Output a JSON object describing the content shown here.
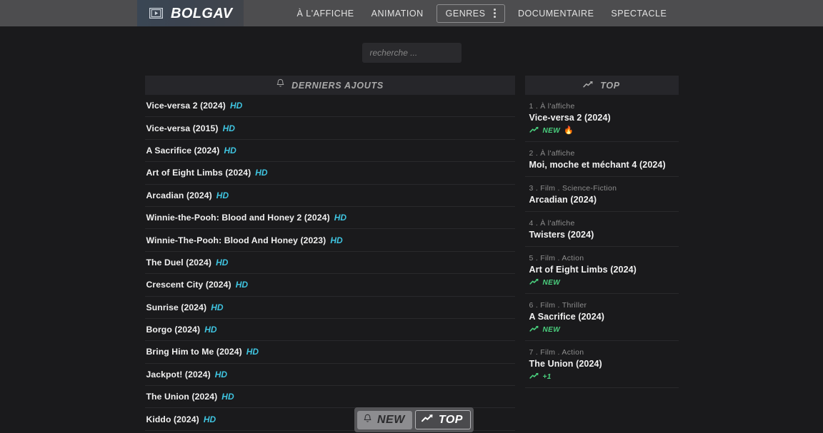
{
  "navbar": {
    "brand": {
      "text": "BOLGAV",
      "icon": "film-play-icon"
    },
    "links": [
      {
        "label": "À L'AFFICHE",
        "name": "nav-a-laffiche",
        "boxed": false
      },
      {
        "label": "ANIMATION",
        "name": "nav-animation",
        "boxed": false
      },
      {
        "label": "GENRES",
        "name": "nav-genres",
        "boxed": true
      },
      {
        "label": "DOCUMENTAIRE",
        "name": "nav-documentaire",
        "boxed": false
      },
      {
        "label": "SPECTACLE",
        "name": "nav-spectacle",
        "boxed": false
      }
    ]
  },
  "search": {
    "placeholder": "recherche ...",
    "value": ""
  },
  "latest": {
    "header": {
      "title": "DERNIERS AJOUTS",
      "icon": "bell-icon"
    },
    "items": [
      {
        "title": "Vice-versa 2 (2024)",
        "tag": "HD"
      },
      {
        "title": "Vice-versa (2015)",
        "tag": "HD"
      },
      {
        "title": "A Sacrifice (2024)",
        "tag": "HD"
      },
      {
        "title": "Art of Eight Limbs (2024)",
        "tag": "HD"
      },
      {
        "title": "Arcadian (2024)",
        "tag": "HD"
      },
      {
        "title": "Winnie-the-Pooh: Blood and Honey 2 (2024)",
        "tag": "HD"
      },
      {
        "title": "Winnie-The-Pooh: Blood And Honey (2023)",
        "tag": "HD"
      },
      {
        "title": "The Duel (2024)",
        "tag": "HD"
      },
      {
        "title": "Crescent City (2024)",
        "tag": "HD"
      },
      {
        "title": "Sunrise (2024)",
        "tag": "HD"
      },
      {
        "title": "Borgo (2024)",
        "tag": "HD"
      },
      {
        "title": "Bring Him to Me (2024)",
        "tag": "HD"
      },
      {
        "title": "Jackpot! (2024)",
        "tag": "HD"
      },
      {
        "title": "The Union (2024)",
        "tag": "HD"
      },
      {
        "title": "Kiddo (2024)",
        "tag": "HD"
      }
    ]
  },
  "top": {
    "header": {
      "title": "TOP",
      "icon": "trending-up-icon"
    },
    "items": [
      {
        "meta": "1 . À l'affiche",
        "name": "Vice-versa 2 (2024)",
        "badge": "NEW",
        "fire": "🔥"
      },
      {
        "meta": "2 . À l'affiche",
        "name": "Moi, moche et méchant 4 (2024)",
        "badge": "",
        "fire": ""
      },
      {
        "meta": "3 . Film . Science-Fiction",
        "name": "Arcadian (2024)",
        "badge": "",
        "fire": ""
      },
      {
        "meta": "4 . À l'affiche",
        "name": "Twisters (2024)",
        "badge": "",
        "fire": ""
      },
      {
        "meta": "5 . Film . Action",
        "name": "Art of Eight Limbs (2024)",
        "badge": "NEW",
        "fire": ""
      },
      {
        "meta": "6 . Film . Thriller",
        "name": "A Sacrifice (2024)",
        "badge": "NEW",
        "fire": ""
      },
      {
        "meta": "7 . Film . Action",
        "name": "The Union (2024)",
        "badge": "+1",
        "fire": ""
      }
    ]
  },
  "floating": {
    "new_label": "NEW",
    "new_icon": "bell-icon",
    "top_label": "TOP",
    "top_icon": "trending-up-icon"
  },
  "colors": {
    "accent_hd": "#3fc4e0",
    "accent_badge": "#4ad07e",
    "navbar_bg": "#4d4d4f",
    "page_bg": "#1a1a1c",
    "panel_head_bg": "#26262a"
  }
}
